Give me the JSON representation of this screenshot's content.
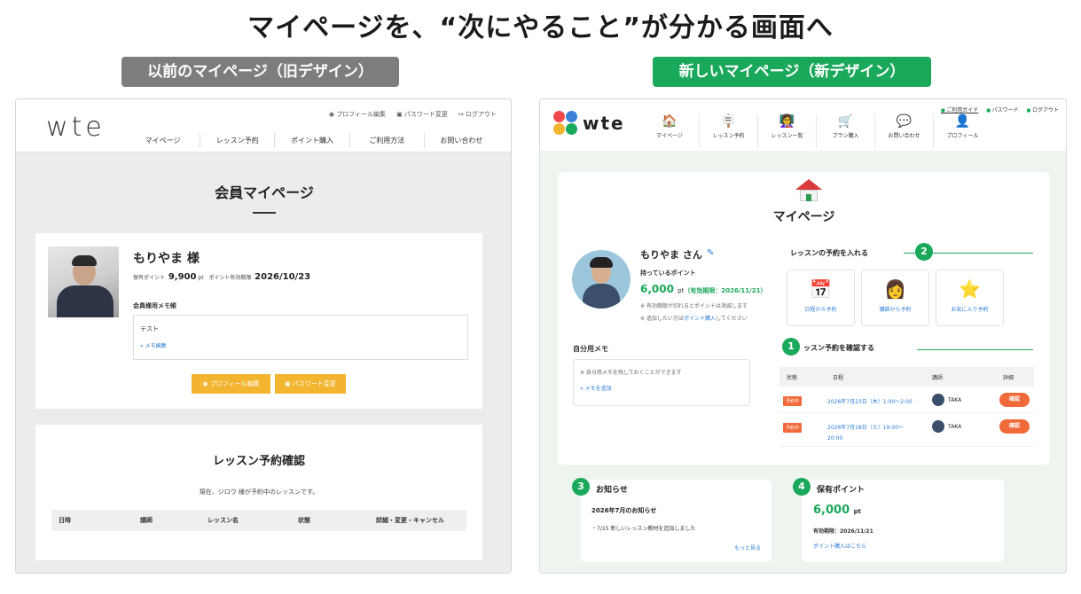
{
  "headline": "マイページを、“次にやること”が分かる画面へ",
  "labels": {
    "old": "以前のマイページ（旧デザイン）",
    "new": "新しいマイページ（新デザイン）"
  },
  "old": {
    "logo": "wte",
    "top_links": [
      "プロフィール編集",
      "パスワード変更",
      "ログアウト"
    ],
    "nav": [
      "マイページ",
      "レッスン予約",
      "ポイント購入",
      "ご利用方法",
      "お問い合わせ"
    ],
    "page_title": "会員マイページ",
    "user_name": "もりやま 様",
    "points_label": "保有ポイント",
    "points_value": "9,900",
    "points_unit": "pt",
    "expiry_label": "ポイント有効期限",
    "expiry_value": "2026/10/23",
    "memo_label": "会員様用メモ帳",
    "memo_text": "テスト",
    "memo_link": "» メモ編集",
    "btn_profile": "プロフィール編集",
    "btn_password": "パスワード変更",
    "reserve_title": "レッスン予約確認",
    "reserve_note": "現在、ジロウ 様が予約中のレッスンです。",
    "table_headers": [
      "日時",
      "講師",
      "レッスン名",
      "状態",
      "詳細・変更・キャンセル"
    ]
  },
  "new": {
    "logo": "wte",
    "top_links": [
      "ご利用ガイド",
      "パスワード",
      "ログアウト"
    ],
    "nav": [
      {
        "label": "マイページ",
        "icon": "🏠"
      },
      {
        "label": "レッスン予約",
        "icon": "🪧"
      },
      {
        "label": "レッスン一覧",
        "icon": "👩‍🏫"
      },
      {
        "label": "プラン購入",
        "icon": "🛒"
      },
      {
        "label": "お問い合わせ",
        "icon": "💬"
      },
      {
        "label": "プロフィール",
        "icon": "👤"
      }
    ],
    "page_title": "マイページ",
    "user_name": "もりやま さん",
    "points_label": "持っているポイント",
    "points_value": "6,000",
    "points_unit": "pt",
    "points_expiry": "（有効期限：2026/11/21）",
    "note_expiry": "※ 有効期限が切れるとポイントは消滅します",
    "note_add_pre": "※ 追加したい方は",
    "note_add_link": "ポイント購入",
    "note_add_post": "してください",
    "memo_label": "自分用メモ",
    "memo_hint": "※ 自分用メモを残しておくことができます",
    "memo_link": "» メモを追加",
    "book_title": "レッスンの予約を入れる",
    "book_badge": "2",
    "book_options": [
      {
        "label": "日程から予約",
        "icon": "📅"
      },
      {
        "label": "講師から予約",
        "icon": "👩"
      },
      {
        "label": "お気に入り予約",
        "icon": "⭐"
      }
    ],
    "confirm_title": "ッスン予約を確認する",
    "confirm_badge": "1",
    "res_headers": [
      "状態",
      "日程",
      "講師",
      "詳細"
    ],
    "reservations": [
      {
        "status": "予約中",
        "date": "2026年7月23日（木）1:00〜2:00",
        "date2": "",
        "teacher": "TAKA",
        "action": "確認"
      },
      {
        "status": "予約中",
        "date": "2026年7月18日（土）19:00〜",
        "date2": "20:00",
        "teacher": "TAKA",
        "action": "確認"
      }
    ],
    "news_badge": "3",
    "news_title": "お知らせ",
    "news_heading": "2026年7月のお知らせ",
    "news_item": "・7/15 新しいレッスン教材を追加しました",
    "news_more": "もっと見る",
    "point_badge": "4",
    "point_title": "保有ポイント",
    "point_value": "6,000",
    "point_unit": "pt",
    "point_expiry": "有効期限：2026/11/21",
    "point_link": "ポイント購入はこちら"
  }
}
